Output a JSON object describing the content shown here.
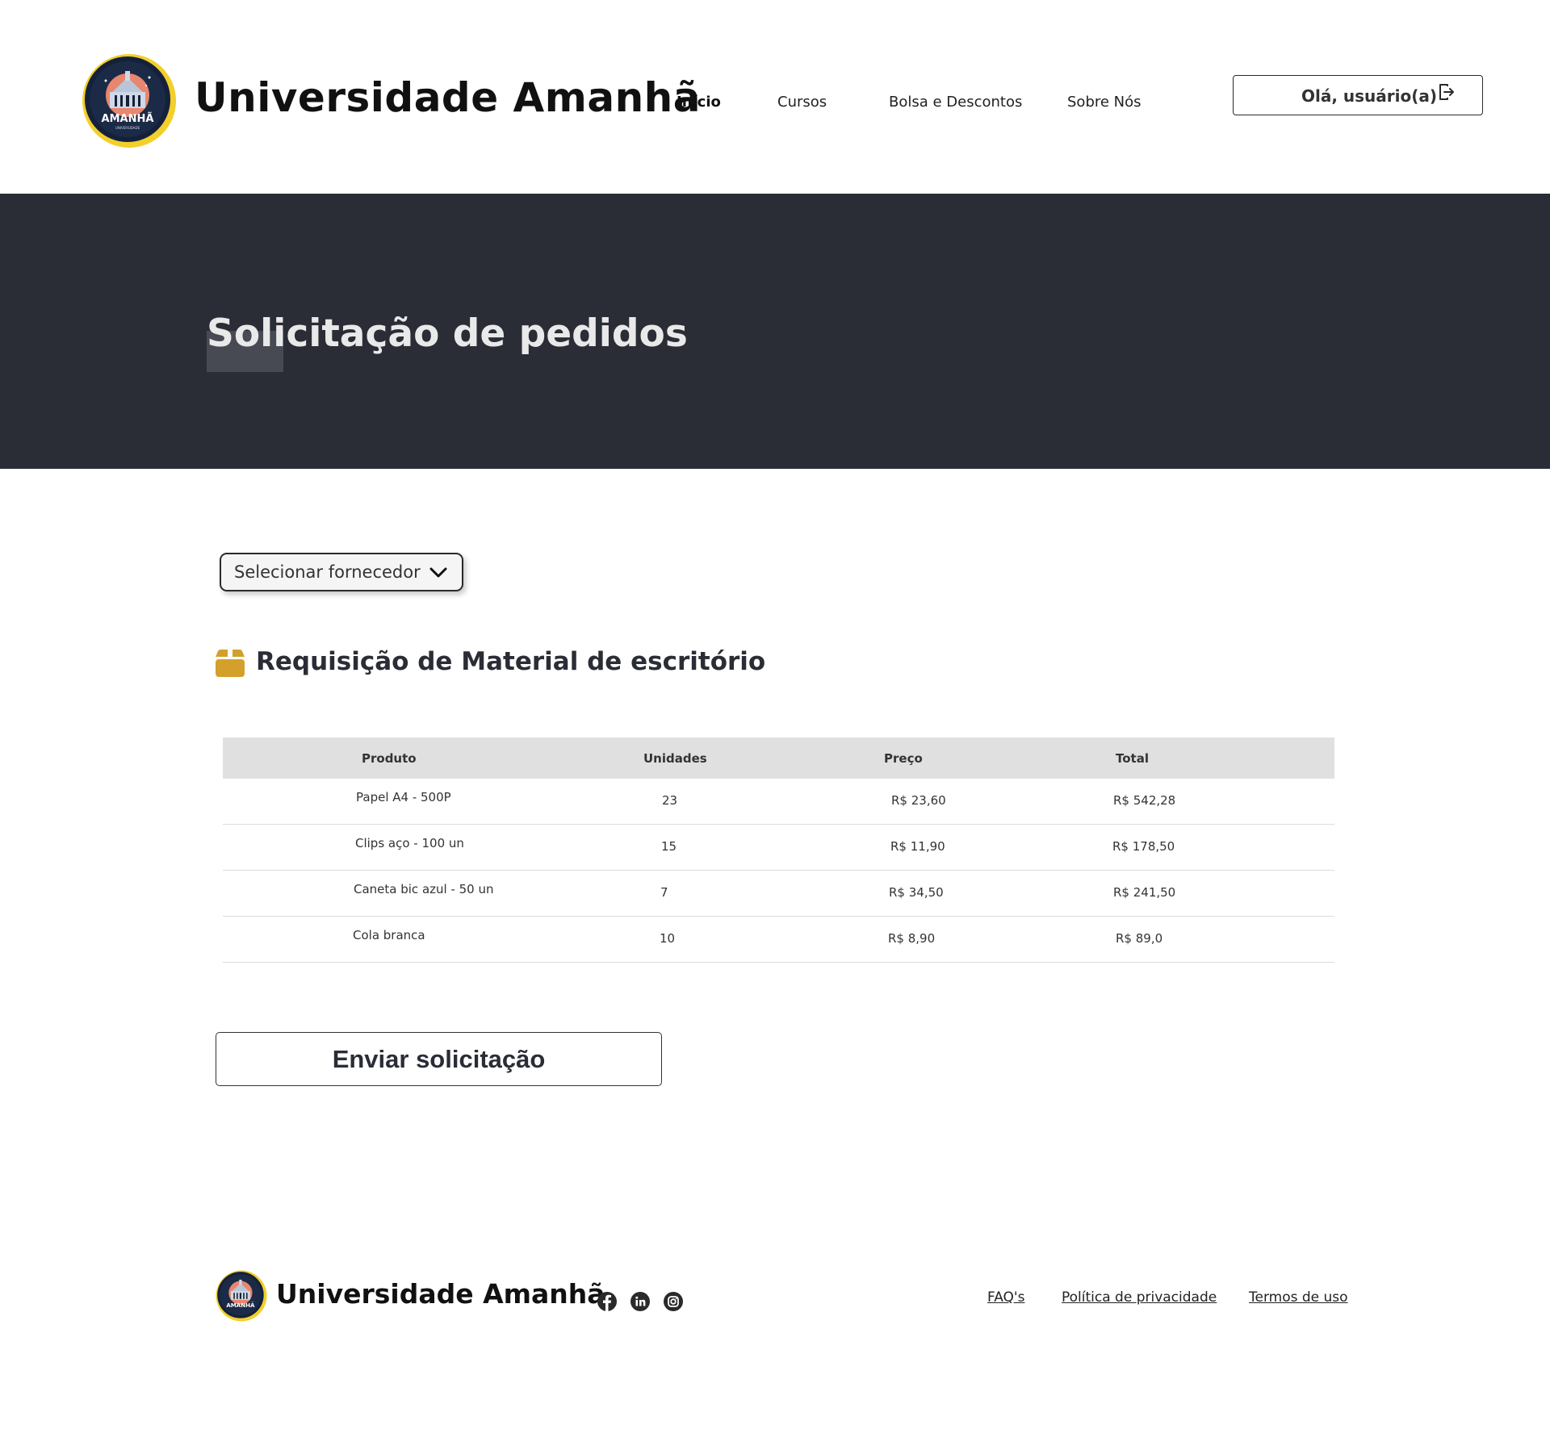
{
  "header": {
    "logo": {
      "badge_text": "AMANHÃ",
      "badge_subtext": "UNIVERSIDADE"
    },
    "title": "Universidade Amanhã",
    "nav": [
      {
        "label": "Início",
        "active": true
      },
      {
        "label": "Cursos",
        "active": false
      },
      {
        "label": "Bolsa e Descontos",
        "active": false
      },
      {
        "label": "Sobre Nós",
        "active": false
      }
    ],
    "user_button": {
      "label": "Olá, usuário(a)",
      "icon": "logout-icon"
    }
  },
  "hero": {
    "title": "Solicitação de pedidos"
  },
  "supplier_select": {
    "label": "Selecionar fornecedor",
    "icon": "chevron-down-icon"
  },
  "section": {
    "title": "Requisição de Material de escritório",
    "icon": "box-icon"
  },
  "table": {
    "columns": [
      "Produto",
      "Unidades",
      "Preço",
      "Total"
    ],
    "rows": [
      [
        "Papel A4 - 500P",
        "23",
        "R$ 23,60",
        "R$ 542,28"
      ],
      [
        "Clips aço - 100 un",
        "15",
        "R$ 11,90",
        "R$ 178,50"
      ],
      [
        "Caneta bic azul - 50 un",
        "7",
        "R$ 34,50",
        "R$ 241,50"
      ],
      [
        "Cola branca",
        "10",
        "R$ 8,90",
        "R$ 89,0"
      ]
    ]
  },
  "submit_button": {
    "label": "Enviar solicitação"
  },
  "footer": {
    "title": "Universidade Amanhã",
    "social": [
      "facebook-icon",
      "linkedin-icon",
      "instagram-icon"
    ],
    "links": [
      "FAQ's",
      "Política de privacidade",
      "Termos de uso"
    ]
  },
  "colors": {
    "hero_bg": "#2a2d35",
    "accent_gold": "#d4a02c",
    "logo_ring": "#f2cf2a",
    "logo_navy": "#15213a",
    "table_header_bg": "#e0e0e0"
  }
}
